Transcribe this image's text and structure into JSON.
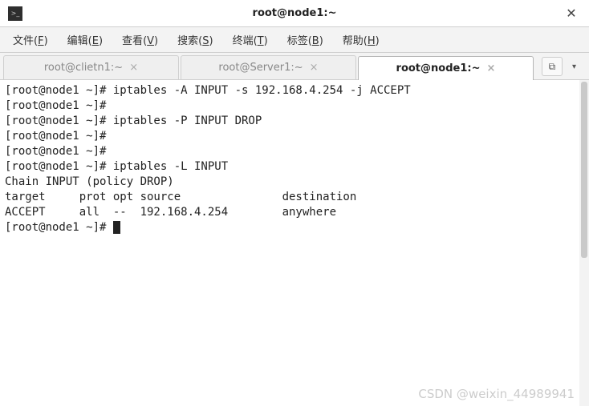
{
  "window": {
    "title": "root@node1:~",
    "close_glyph": "✕"
  },
  "menu": {
    "file": {
      "label": "文件",
      "accel": "F"
    },
    "edit": {
      "label": "编辑",
      "accel": "E"
    },
    "view": {
      "label": "查看",
      "accel": "V"
    },
    "search": {
      "label": "搜索",
      "accel": "S"
    },
    "term": {
      "label": "终端",
      "accel": "T"
    },
    "tabs": {
      "label": "标签",
      "accel": "B"
    },
    "help": {
      "label": "帮助",
      "accel": "H"
    }
  },
  "tabs": [
    {
      "label": "root@clietn1:~",
      "active": false
    },
    {
      "label": "root@Server1:~",
      "active": false
    },
    {
      "label": "root@node1:~",
      "active": true
    }
  ],
  "tab_close_glyph": "×",
  "toolbox": {
    "icon_label": "⧉",
    "chev": "▾"
  },
  "terminal": {
    "lines": [
      "[root@node1 ~]# iptables -A INPUT -s 192.168.4.254 -j ACCEPT",
      "[root@node1 ~]# ",
      "[root@node1 ~]# iptables -P INPUT DROP",
      "[root@node1 ~]# ",
      "[root@node1 ~]# ",
      "[root@node1 ~]# iptables -L INPUT",
      "Chain INPUT (policy DROP)",
      "target     prot opt source               destination         ",
      "ACCEPT     all  --  192.168.4.254        anywhere            ",
      "[root@node1 ~]# "
    ]
  },
  "watermark": "CSDN @weixin_44989941"
}
